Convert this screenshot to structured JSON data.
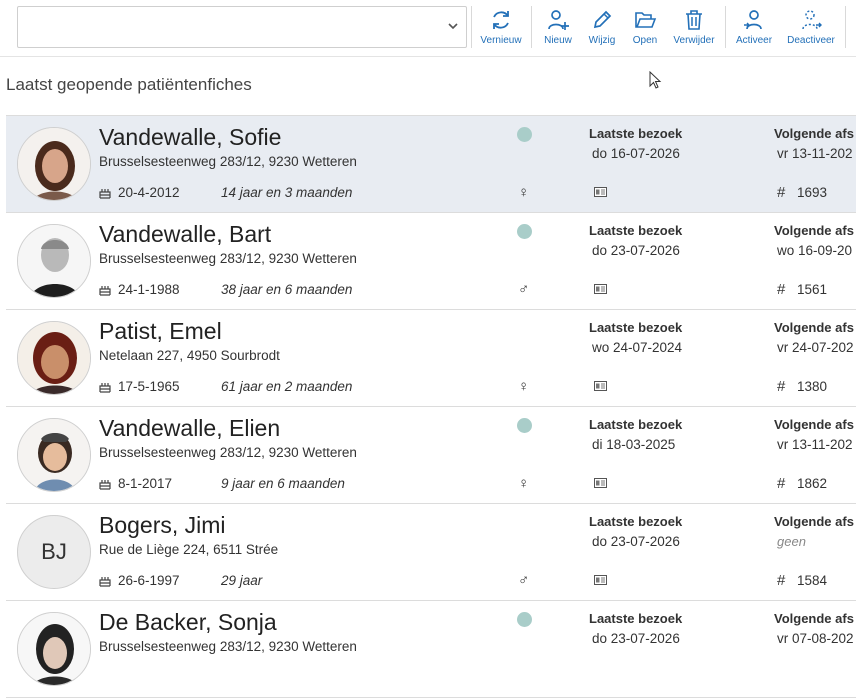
{
  "toolbar": {
    "search_value": "",
    "buttons": [
      {
        "label": "Vernieuw",
        "icon": "refresh-icon"
      },
      {
        "label": "Nieuw",
        "icon": "add-user-icon"
      },
      {
        "label": "Wijzig",
        "icon": "pencil-icon"
      },
      {
        "label": "Open",
        "icon": "folder-open-icon"
      },
      {
        "label": "Verwijder",
        "icon": "trash-icon"
      },
      {
        "label": "Activeer",
        "icon": "user-activate-icon"
      },
      {
        "label": "Deactiveer",
        "icon": "user-deactivate-icon"
      }
    ]
  },
  "heading": "Laatst geopende patiëntenfiches",
  "patients": [
    {
      "name": "Vandewalle, Sofie",
      "address": "Brusselsesteenweg 283/12, 9230 Wetteren",
      "dob": "20-4-2012",
      "age": "14 jaar en 3 maanden",
      "gender": "♀",
      "last_visit_label": "Laatste bezoek",
      "last_visit": "do 16-07-2026",
      "next_label": "Volgende afs",
      "next": "vr 13-11-202",
      "number": "1693",
      "status_dot": true,
      "initials": "",
      "selected": true
    },
    {
      "name": "Vandewalle, Bart",
      "address": "Brusselsesteenweg 283/12, 9230 Wetteren",
      "dob": "24-1-1988",
      "age": "38 jaar en 6 maanden",
      "gender": "♂",
      "last_visit_label": "Laatste bezoek",
      "last_visit": "do 23-07-2026",
      "next_label": "Volgende afs",
      "next": "wo 16-09-20",
      "number": "1561",
      "status_dot": true,
      "initials": "",
      "selected": false
    },
    {
      "name": "Patist, Emel",
      "address": "Netelaan 227, 4950 Sourbrodt",
      "dob": "17-5-1965",
      "age": "61 jaar en 2 maanden",
      "gender": "♀",
      "last_visit_label": "Laatste bezoek",
      "last_visit": "wo 24-07-2024",
      "next_label": "Volgende afs",
      "next": "vr 24-07-202",
      "number": "1380",
      "status_dot": false,
      "initials": "",
      "selected": false
    },
    {
      "name": "Vandewalle, Elien",
      "address": "Brusselsesteenweg 283/12, 9230 Wetteren",
      "dob": "8-1-2017",
      "age": "9 jaar en 6 maanden",
      "gender": "♀",
      "last_visit_label": "Laatste bezoek",
      "last_visit": "di 18-03-2025",
      "next_label": "Volgende afs",
      "next": "vr 13-11-202",
      "number": "1862",
      "status_dot": true,
      "initials": "",
      "selected": false
    },
    {
      "name": "Bogers, Jimi",
      "address": "Rue de Liège 224, 6511 Strée",
      "dob": "26-6-1997",
      "age": "29 jaar",
      "gender": "♂",
      "last_visit_label": "Laatste bezoek",
      "last_visit": "do 23-07-2026",
      "next_label": "Volgende afs",
      "next": "geen",
      "number": "1584",
      "status_dot": false,
      "initials": "BJ",
      "selected": false
    },
    {
      "name": "De Backer, Sonja",
      "address": "Brusselsesteenweg 283/12, 9230 Wetteren",
      "dob": "",
      "age": "",
      "gender": "",
      "last_visit_label": "Laatste bezoek",
      "last_visit": "do 23-07-2026",
      "next_label": "Volgende afs",
      "next": "vr 07-08-202",
      "number": "",
      "status_dot": true,
      "initials": "",
      "selected": false
    }
  ],
  "colors": {
    "accent": "#2370b8",
    "selected_row": "#e8ecf2",
    "status_dot": "#a9cdc9"
  }
}
